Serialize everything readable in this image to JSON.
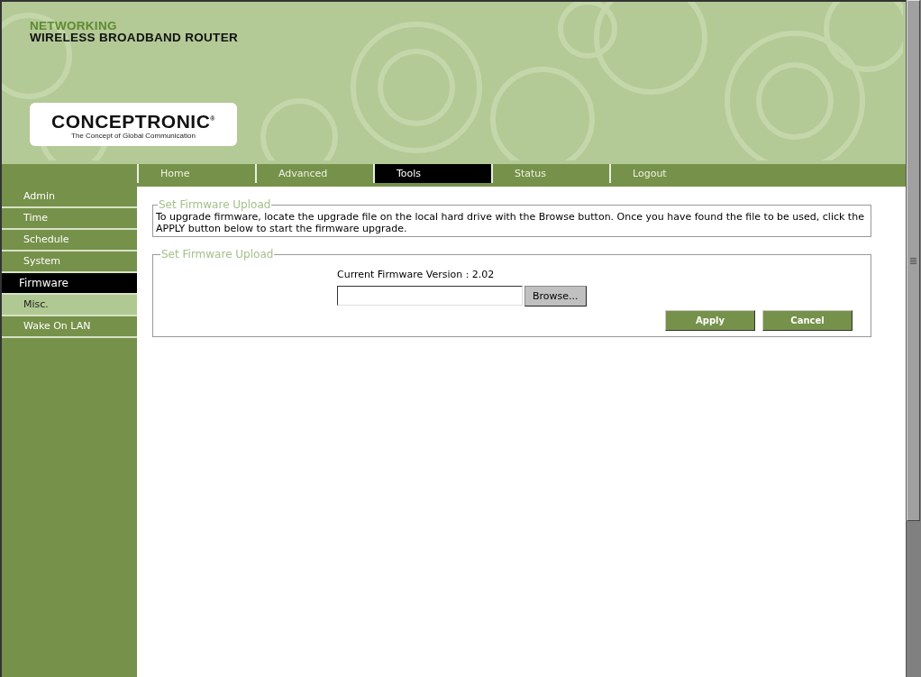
{
  "header": {
    "subtitle": "NETWORKING",
    "title": "WIRELESS BROADBAND ROUTER",
    "logo": {
      "name": "CONCEPTRONIC",
      "mark": "®",
      "tagline": "The Concept of Global Communication"
    }
  },
  "tabs": [
    {
      "label": "Home",
      "selected": false
    },
    {
      "label": "Advanced",
      "selected": false
    },
    {
      "label": "Tools",
      "selected": true
    },
    {
      "label": "Status",
      "selected": false
    },
    {
      "label": "Logout",
      "selected": false
    }
  ],
  "sidebar": {
    "items": [
      {
        "label": "Admin",
        "selected": false,
        "hovered": false
      },
      {
        "label": "Time",
        "selected": false,
        "hovered": false
      },
      {
        "label": "Schedule",
        "selected": false,
        "hovered": false
      },
      {
        "label": "System",
        "selected": false,
        "hovered": false
      },
      {
        "label": "Firmware",
        "selected": true,
        "hovered": false
      },
      {
        "label": "Misc.",
        "selected": false,
        "hovered": true
      },
      {
        "label": "Wake On LAN",
        "selected": false,
        "hovered": false
      }
    ]
  },
  "info_section": {
    "legend": "Set Firmware Upload",
    "text": "To upgrade firmware, locate the upgrade file on the local hard drive with the Browse button. Once you have found the file to be used, click the APPLY button below to start the firmware upgrade."
  },
  "upload_section": {
    "legend": "Set Firmware Upload",
    "version_label": "Current Firmware Version : 2.02",
    "browse_button": "Browse...",
    "buttons": [
      "Apply",
      "Cancel"
    ]
  }
}
